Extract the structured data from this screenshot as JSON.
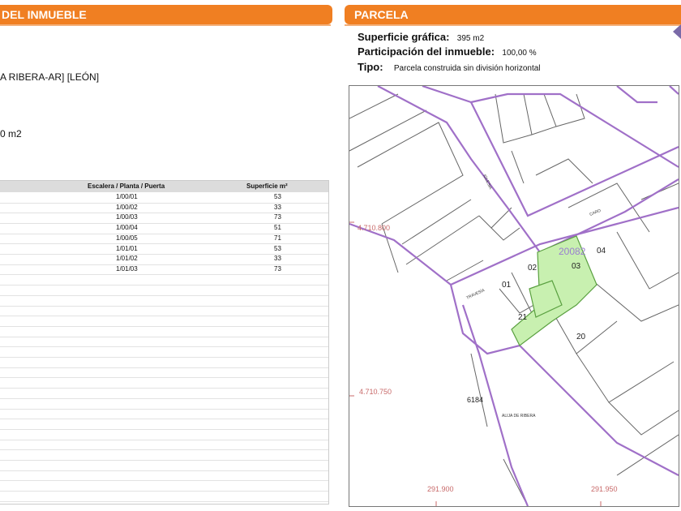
{
  "left_panel": {
    "header": "DEL INMUEBLE",
    "location": "A RIBERA-AR] [LEÓN]",
    "surface": "0 m2",
    "table": {
      "columns": [
        "Escalera / Planta / Puerta",
        "Superficie m²"
      ],
      "rows": [
        [
          "1/00/01",
          "53"
        ],
        [
          "1/00/02",
          "33"
        ],
        [
          "1/00/03",
          "73"
        ],
        [
          "1/00/04",
          "51"
        ],
        [
          "1/00/05",
          "71"
        ],
        [
          "1/01/01",
          "53"
        ],
        [
          "1/01/02",
          "33"
        ],
        [
          "1/01/03",
          "73"
        ]
      ]
    }
  },
  "right_panel": {
    "header": "PARCELA",
    "fields": [
      {
        "label": "Superficie gráfica:",
        "value": "395 m2"
      },
      {
        "label": "Participación del inmueble:",
        "value": "100,00 %"
      },
      {
        "label": "Tipo:",
        "value": "Parcela construida sin división horizontal"
      }
    ],
    "map": {
      "coord_y_top": "4.710.800",
      "coord_y_bottom": "4.710.750",
      "coord_x_left": "291.900",
      "coord_x_right": "291.950",
      "parcel_ref": "20082",
      "plot_numbers": [
        "01",
        "02",
        "03",
        "04",
        "20",
        "21",
        "6184"
      ],
      "street_labels": [
        "TRAVESÍA",
        "IGLESIA",
        "CARO",
        "ALIJA DE RIBERA"
      ],
      "colors": {
        "boundary": "#a070c8",
        "highlight_fill": "#c8f0b0",
        "highlight_stroke": "#5aa040",
        "accent": "#f07f22"
      }
    }
  }
}
